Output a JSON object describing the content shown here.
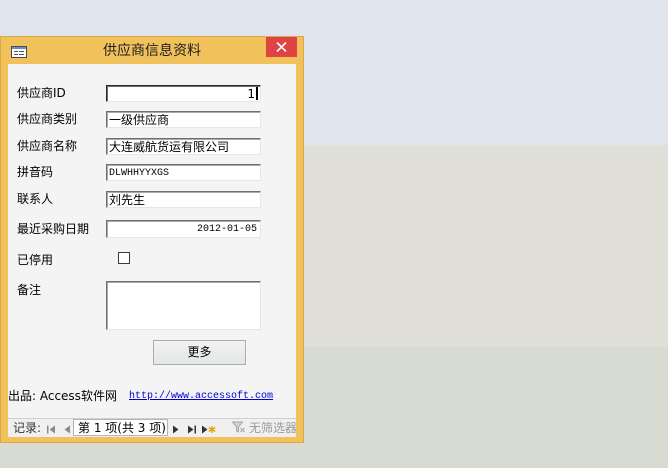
{
  "window": {
    "title": "供应商信息资料",
    "icon": "form-icon",
    "close_icon": "close-icon"
  },
  "form": {
    "supplier_id": {
      "label": "供应商ID",
      "value": "1"
    },
    "category": {
      "label": "供应商类别",
      "value": "一级供应商"
    },
    "name": {
      "label": "供应商名称",
      "value": "大连威航货运有限公司"
    },
    "pinyin_code": {
      "label": "拼音码",
      "value": "DLWHHYYXGS"
    },
    "contact": {
      "label": "联系人",
      "value": "刘先生"
    },
    "last_purchase_date": {
      "label": "最近采购日期",
      "value": "2012-01-05"
    },
    "discontinued": {
      "label": "已停用",
      "checked": false
    },
    "notes": {
      "label": "备注",
      "value": ""
    },
    "more_button": {
      "label": "更多"
    }
  },
  "footer": {
    "credit": "出品: Access软件网",
    "link": "http://www.accessoft.com"
  },
  "record_navigator": {
    "label": "记录:",
    "position": "第 1 项(共 3 项)",
    "filter_status": "无筛选器",
    "icons": {
      "first": "first-record-icon",
      "previous": "previous-record-icon",
      "next": "next-record-icon",
      "last": "last-record-icon",
      "new": "new-record-icon",
      "filter": "filter-icon"
    }
  },
  "colors": {
    "window_frame": "#f1c15c",
    "close_button": "#e04343",
    "link": "#0000cc",
    "form_background": "#f4f4f4"
  }
}
